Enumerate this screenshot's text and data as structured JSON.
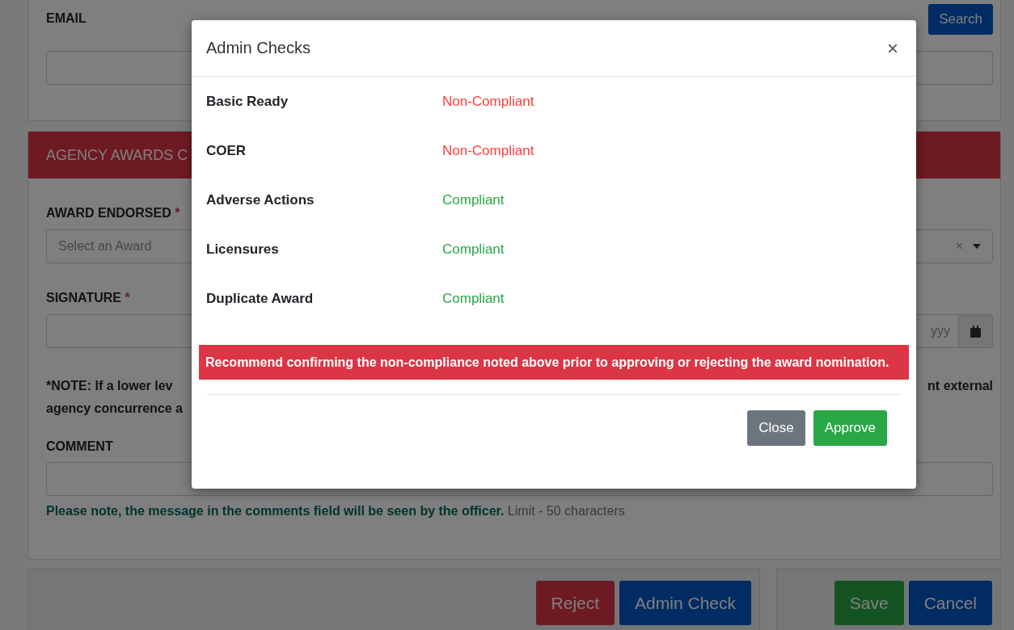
{
  "page": {
    "email": {
      "label": "EMAIL",
      "search_button": "Search"
    },
    "section": {
      "title": "AGENCY AWARDS C",
      "award": {
        "label": "AWARD ENDORSED",
        "required": "*",
        "placeholder": "Select an Award",
        "clear": "×"
      },
      "signature": {
        "label": "SIGNATURE",
        "required": "*",
        "date_placeholder": "yyy"
      },
      "note": {
        "left": "*NOTE: If a lower lev agency concurrence a",
        "right": "nt external"
      },
      "comment": {
        "label": "COMMENT",
        "help": "**Please note, the message in the comments field will be seen by the officer.** Limit - 50 characters"
      }
    },
    "actions_left": [
      "Reject",
      "Admin Check"
    ],
    "actions_right": [
      "Save",
      "Cancel"
    ]
  },
  "modal": {
    "title": "Admin Checks",
    "close": "×",
    "checks": [
      {
        "label": "Basic Ready",
        "status": "Non-Compliant",
        "compliant": false
      },
      {
        "label": "COER",
        "status": "Non-Compliant",
        "compliant": false
      },
      {
        "label": "Adverse Actions",
        "status": "Compliant",
        "compliant": true
      },
      {
        "label": "Licensures",
        "status": "Compliant",
        "compliant": true
      },
      {
        "label": "Duplicate Award",
        "status": "Compliant",
        "compliant": true
      }
    ],
    "alert": "Recommend confirming the non-compliance noted above prior to approving or rejecting the award nomination.",
    "buttons": [
      {
        "label": "Close",
        "kind": "secondary"
      },
      {
        "label": "Approve",
        "kind": "success"
      }
    ]
  }
}
